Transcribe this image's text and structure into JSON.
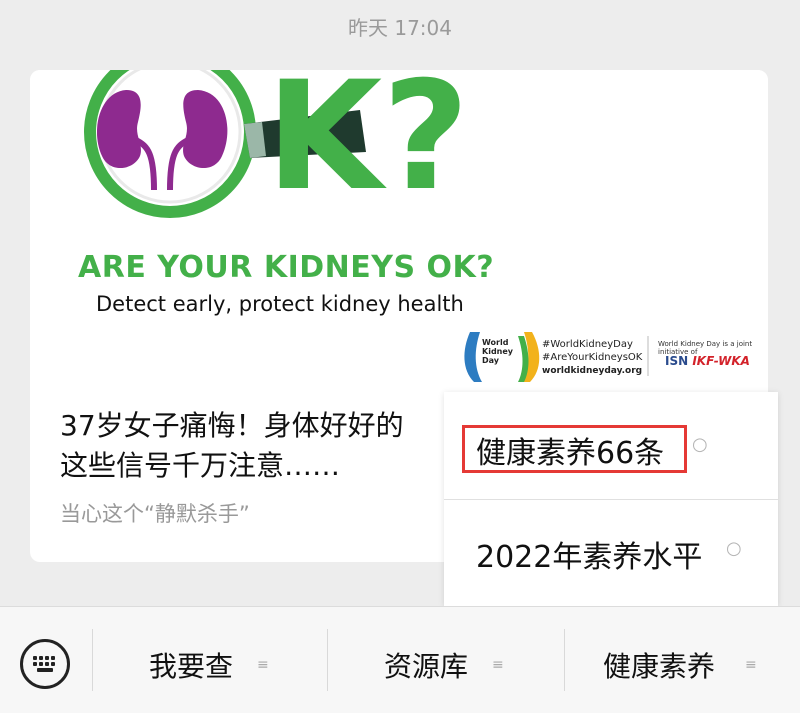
{
  "timestamp": "昨天 17:04",
  "card": {
    "banner": {
      "big_text": "K?",
      "headline": "ARE YOUR KIDNEYS OK?",
      "subline": "Detect early, protect kidney health",
      "logo_text_1": "World",
      "logo_text_2": "Kidney",
      "logo_text_3": "Day",
      "hashtag_1": "#WorldKidneyDay",
      "hashtag_2": "#AreYourKidneysOK",
      "url": "worldkidneyday.org",
      "joint_note": "World Kidney Day is a joint initiative of",
      "isn": "ISN",
      "ikf": "IKF-WKA"
    },
    "title_line1": "37岁女子痛悔！身体好好的",
    "title_line2": "这些信号千万注意……",
    "subtitle": "当心这个“静默杀手”"
  },
  "popup": {
    "items": [
      {
        "label": "健康素养66条",
        "icon": "chat-bubble-icon",
        "highlighted": true
      },
      {
        "label": "2022年素养水平",
        "icon": "chat-bubble-icon",
        "highlighted": false
      }
    ],
    "highlight_color": "#e53935"
  },
  "menu": {
    "keyboard_icon": "keyboard-icon",
    "items": [
      {
        "label": "我要查",
        "icon": "menu-lines-icon"
      },
      {
        "label": "资源库",
        "icon": "menu-lines-icon"
      },
      {
        "label": "健康素养",
        "icon": "menu-lines-icon"
      }
    ]
  },
  "colors": {
    "accent_green": "#43b049",
    "kidney_purple": "#8e2a8f",
    "background": "#ededed"
  }
}
